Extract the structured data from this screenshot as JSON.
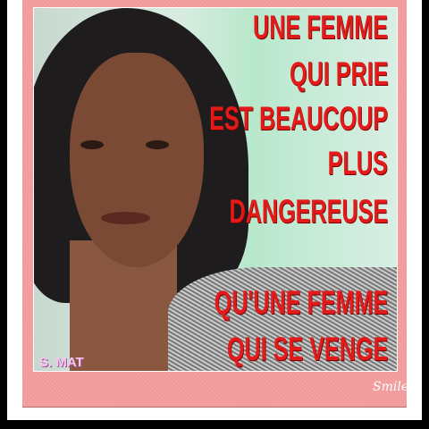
{
  "quote_lines": [
    "UNE FEMME",
    "QUI PRIE",
    "EST BEAUCOUP",
    "PLUS",
    "DANGEREUSE",
    "QU'UNE FEMME",
    "QUI SE VENGE"
  ],
  "signature": "S. MAT",
  "frame_caption": "Smile",
  "colors": {
    "text": "#e21a1a",
    "frame": "#f29a9a"
  }
}
